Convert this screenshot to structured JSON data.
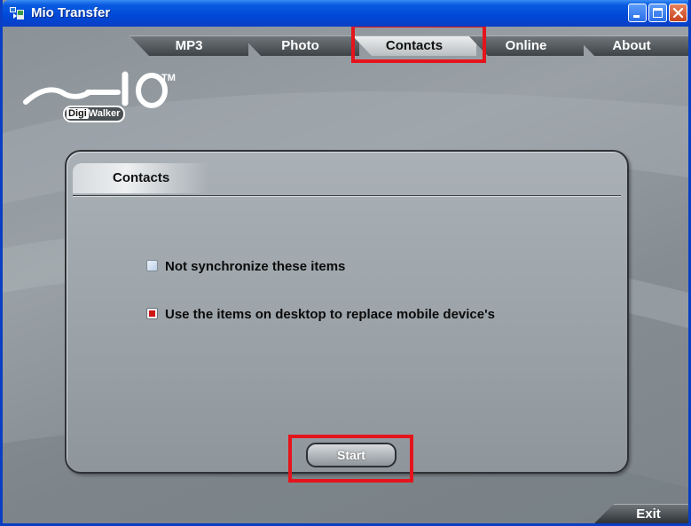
{
  "window": {
    "title": "Mio Transfer",
    "accent_color": "#0a4fd8"
  },
  "tabs": [
    {
      "label": "MP3",
      "active": false
    },
    {
      "label": "Photo",
      "active": false
    },
    {
      "label": "Contacts",
      "active": true
    },
    {
      "label": "Online",
      "active": false
    },
    {
      "label": "About",
      "active": false
    }
  ],
  "logo": {
    "wordmark": "Mio",
    "trademark": "TM",
    "badge_highlight": "Digi",
    "badge_rest": "Walker"
  },
  "panel": {
    "title": "Contacts",
    "options": [
      {
        "label": "Not synchronize these items",
        "checked": false
      },
      {
        "label": "Use the items on desktop to replace mobile device's",
        "checked": true
      }
    ],
    "start_label": "Start"
  },
  "footer": {
    "exit_label": "Exit"
  },
  "highlight_color": "#e5141c"
}
